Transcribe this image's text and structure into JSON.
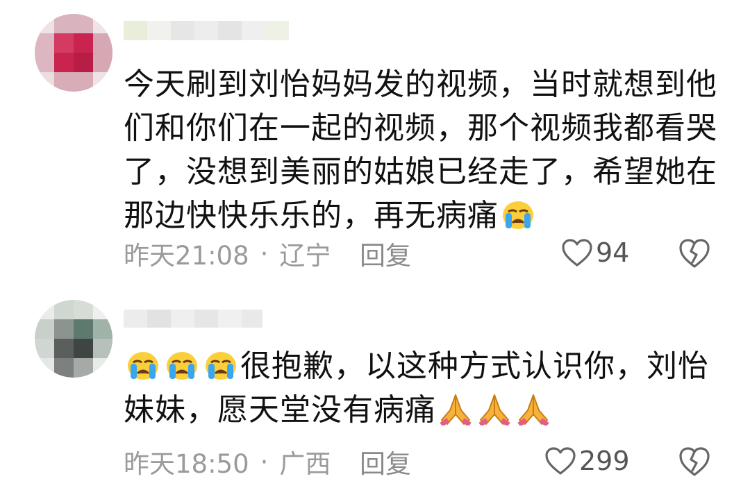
{
  "comments": [
    {
      "text_lines": [
        "今天刷到刘怡妈妈发的视频，当时就想到他",
        "们和你们在一起的视频，那个视频我都看哭",
        "了，没想到美丽的姑娘已经走了，希望她在",
        "那边快快乐乐的，再无病痛"
      ],
      "emoji_after_text": [
        "crying-face-icon"
      ],
      "time": "昨天21:08",
      "separator": "·",
      "location": "辽宁",
      "reply_label": "回复",
      "likes": "94"
    },
    {
      "emoji_before_text": [
        "crying-face-icon",
        "crying-face-icon",
        "crying-face-icon"
      ],
      "text_lines": [
        "很抱歉，以这种方式认识你，刘怡",
        "妹妹，愿天堂没有病痛"
      ],
      "emoji_after_text": [
        "folded-hands-icon",
        "folded-hands-icon",
        "folded-hands-icon"
      ],
      "time": "昨天18:50",
      "separator": "·",
      "location": "广西",
      "reply_label": "回复",
      "likes": "299"
    }
  ],
  "colors": {
    "text": "#111111",
    "meta": "#9a9a9a",
    "icon_stroke": "#666666"
  }
}
